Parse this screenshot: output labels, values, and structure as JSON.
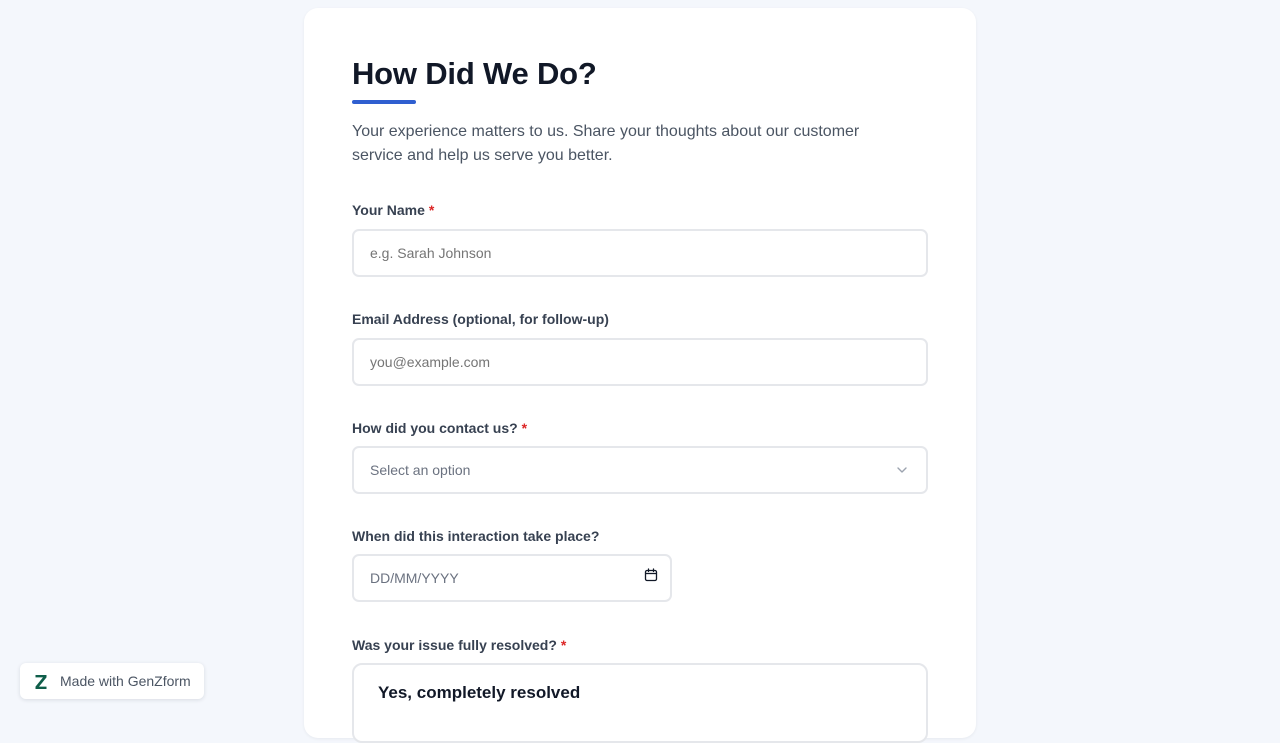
{
  "form": {
    "title": "How Did We Do?",
    "subtitle": "Your experience matters to us. Share your thoughts about our customer service and help us serve you better.",
    "required_marker": "*",
    "fields": {
      "name": {
        "label": "Your Name",
        "placeholder": "e.g. Sarah Johnson",
        "value": ""
      },
      "email": {
        "label": "Email Address (optional, for follow-up)",
        "placeholder": "you@example.com",
        "value": ""
      },
      "contact_method": {
        "label": "How did you contact us?",
        "selected": "Select an option"
      },
      "interaction_date": {
        "label": "When did this interaction take place?",
        "placeholder": "DD/MM/YYYY"
      },
      "resolved": {
        "label": "Was your issue fully resolved?",
        "options": [
          "Yes, completely resolved"
        ]
      }
    }
  },
  "branding": {
    "badge_text": "Made with GenZform",
    "logo_icon": "genzform-logo-icon"
  },
  "colors": {
    "accent": "#2f5fd0",
    "required": "#dc2626",
    "background": "#f4f7fc",
    "logo": "#0f5e4a"
  }
}
